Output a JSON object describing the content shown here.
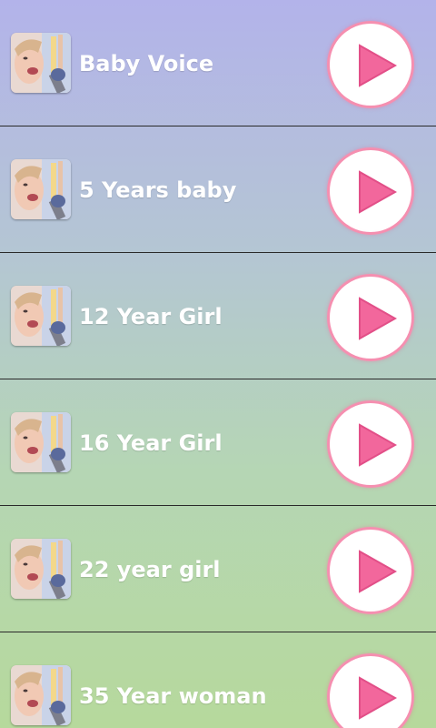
{
  "items": [
    {
      "label": "Baby Voice"
    },
    {
      "label": "5 Years baby"
    },
    {
      "label": "12 Year Girl"
    },
    {
      "label": "16 Year Girl"
    },
    {
      "label": "22 year girl"
    },
    {
      "label": "35 Year woman"
    }
  ],
  "icons": {
    "thumbnail": "singer-photo-icon",
    "play": "play-icon"
  },
  "colors": {
    "play_triangle": "#f2679c",
    "play_ring": "#f58fb0",
    "divider": "#2a2a2a",
    "label_text": "#ffffff"
  }
}
